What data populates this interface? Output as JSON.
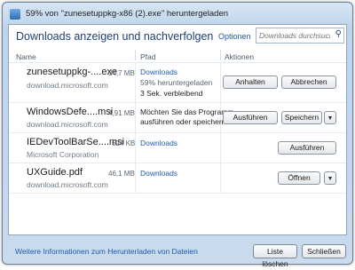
{
  "window": {
    "title": "59% von \"zunesetuppkg-x86 (2).exe\" heruntergeladen"
  },
  "header": {
    "title": "Downloads anzeigen und nachverfolgen",
    "options_label": "Optionen",
    "search_placeholder": "Downloads durchsuchen"
  },
  "columns": {
    "name": "Name",
    "path": "Pfad",
    "actions": "Aktionen"
  },
  "downloads": [
    {
      "name": "zunesetuppkg-....exe",
      "size": "34,7 MB",
      "source": "download.microsoft.com",
      "path": "Downloads",
      "progress_text": "59% heruntergeladen",
      "time_left": "3 Sek. verbleibend",
      "progress": 0.59,
      "actions": [
        "Anhalten",
        "Abbrechen"
      ]
    },
    {
      "name": "WindowsDefe....msi",
      "size": "4,91 MB",
      "source": "download.microsoft.com",
      "prompt_line1": "Möchten Sie das Programm",
      "prompt_line2": "ausführen oder speichern?",
      "actions": [
        "Ausführen",
        "Speichern"
      ]
    },
    {
      "name": "IEDevToolBarSe....msi",
      "size": "624 KB",
      "source": "Microsoft Corporation",
      "path": "Downloads",
      "actions": [
        "Ausführen"
      ]
    },
    {
      "name": "UXGuide.pdf",
      "size": "46,1 MB",
      "source": "download.microsoft.com",
      "path": "Downloads",
      "actions": [
        "Öffnen"
      ]
    }
  ],
  "footer": {
    "more_info_link": "Weitere Informationen zum Herunterladen von Dateien",
    "clear_list": "Liste löschen",
    "close": "Schließen"
  },
  "icons": {
    "title": "ie-download-icon",
    "search": "search-icon",
    "dropdown": "dropdown-arrow-icon"
  }
}
